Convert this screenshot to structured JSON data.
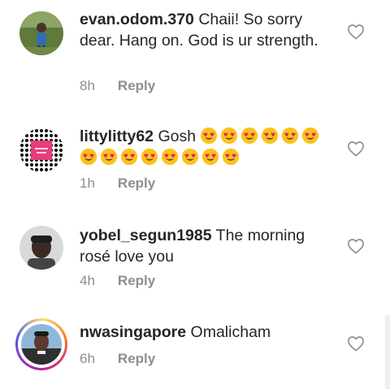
{
  "comments": [
    {
      "username": "evan.odom.370",
      "text": "Chaii!  So sorry dear. Hang on. God is ur strength.",
      "time": "8h",
      "reply_label": "Reply",
      "like_icon": "heart-outline-icon"
    },
    {
      "username": "littylitty62",
      "text": "Gosh",
      "emoji_count": 14,
      "emoji_icon": "heart-eyes-emoji",
      "time": "1h",
      "reply_label": "Reply",
      "like_icon": "heart-outline-icon"
    },
    {
      "username": "yobel_segun1985",
      "text": "The morning rosé love you",
      "time": "4h",
      "reply_label": "Reply",
      "like_icon": "heart-outline-icon"
    },
    {
      "username": "nwasingapore",
      "text": "Omalicham",
      "time": "6h",
      "reply_label": "Reply",
      "like_icon": "heart-outline-icon"
    }
  ],
  "colors": {
    "text": "#262626",
    "meta": "#8e8e8e",
    "emoji_face": "#fcc21b",
    "emoji_heart": "#e0245e",
    "story_ring": "#d6249f"
  }
}
